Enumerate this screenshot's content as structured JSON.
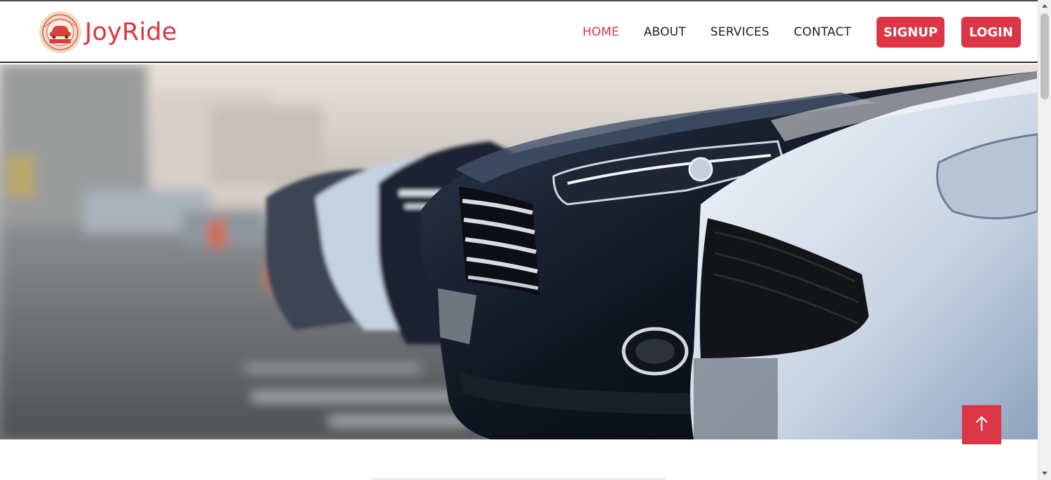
{
  "brand": {
    "name": "JoyRide",
    "logo_text": "JOY RIDE",
    "logo_icon": "car-badge-icon",
    "color": "#dc3545"
  },
  "nav": {
    "items": [
      {
        "label": "HOME",
        "active": true
      },
      {
        "label": "ABOUT",
        "active": false
      },
      {
        "label": "SERVICES",
        "active": false
      },
      {
        "label": "CONTACT",
        "active": false
      }
    ],
    "signup_label": "SIGNUP",
    "login_label": "LOGIN"
  },
  "hero": {
    "image": "row-of-parked-cars-photo"
  },
  "scroll_top": {
    "icon": "arrow-up-icon"
  },
  "colors": {
    "accent": "#dc3545",
    "text": "#1f1f1f",
    "background": "#ffffff"
  }
}
